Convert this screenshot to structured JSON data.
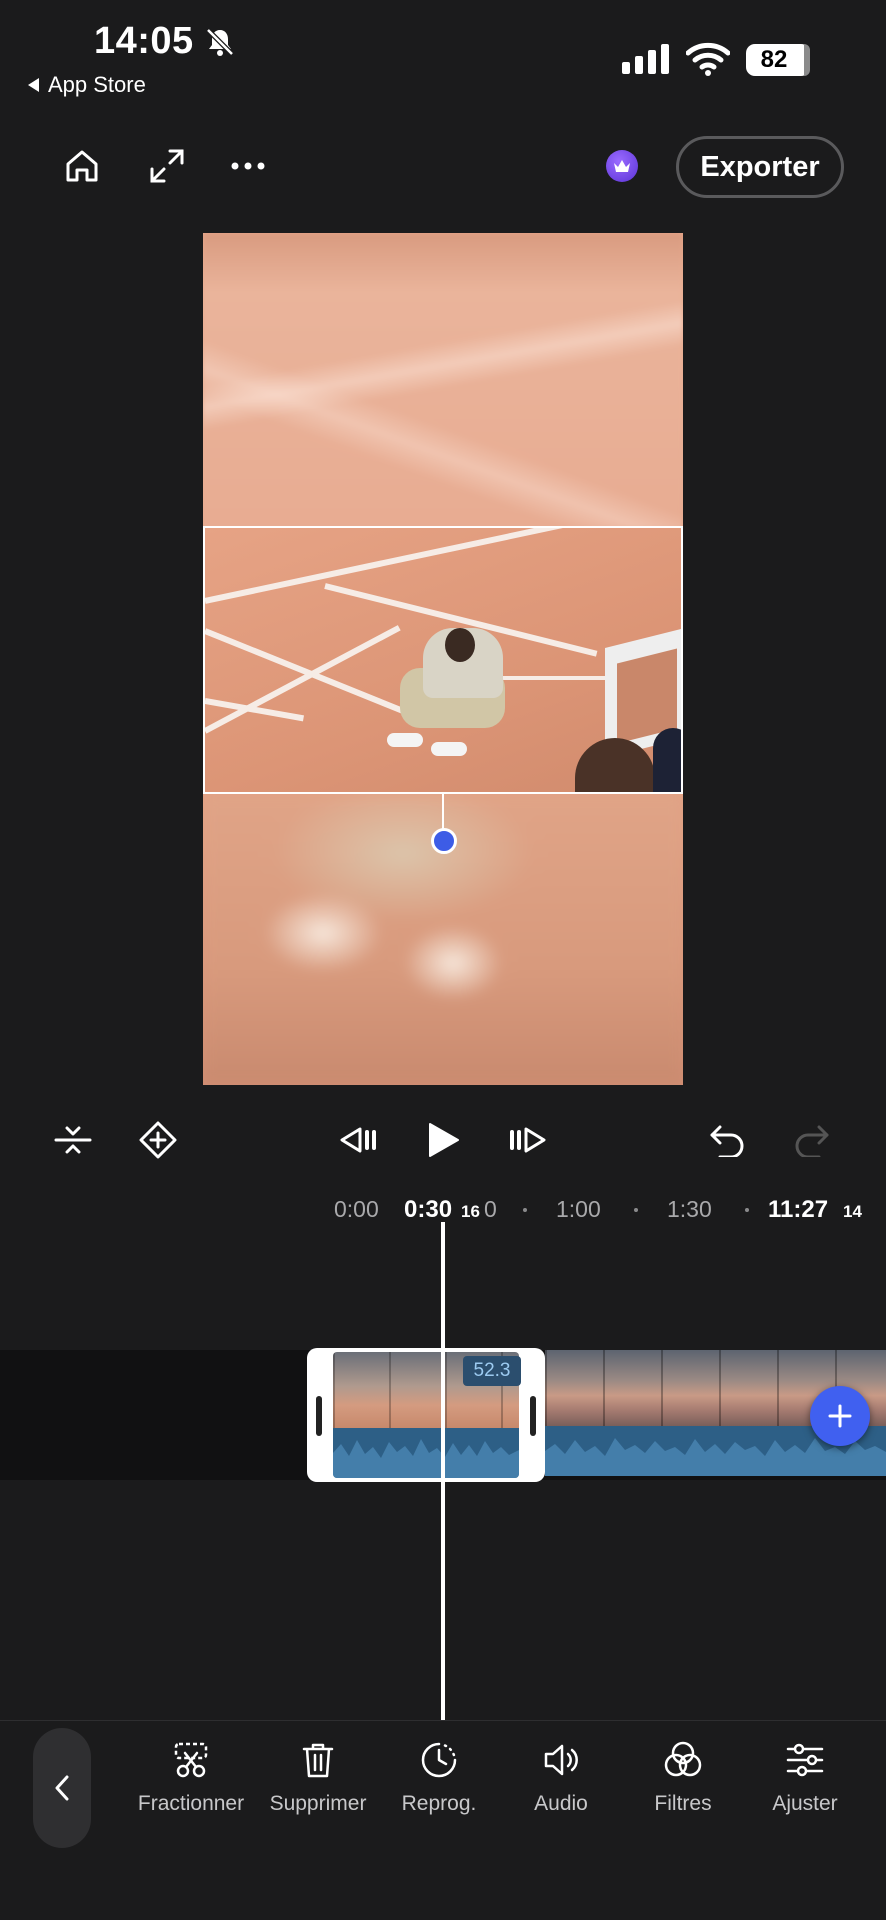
{
  "status_bar": {
    "time": "14:05",
    "back_app": "App Store",
    "battery": "82"
  },
  "toolbar": {
    "home_icon": "home-icon",
    "fullscreen_icon": "expand-icon",
    "more_icon": "more-icon",
    "premium_icon": "crown-icon",
    "export_label": "Exporter"
  },
  "playback": {
    "split_view_icon": "split-vertical-icon",
    "keyframe_icon": "keyframe-add-icon",
    "prev_frame_icon": "step-back-icon",
    "play_icon": "play-icon",
    "next_frame_icon": "step-forward-icon",
    "undo_icon": "undo-icon",
    "redo_icon": "redo-icon"
  },
  "ruler": {
    "marks": [
      "0:00",
      "1:00",
      "1:30"
    ],
    "partial_mark": "0",
    "current_time": "0:30",
    "current_frames": "16",
    "total_time": "11:27",
    "total_frames": "14"
  },
  "timeline": {
    "clip_speed": "52.3",
    "add_icon": "plus-icon"
  },
  "bottom_tools": {
    "back_icon": "chevron-left-icon",
    "items": [
      {
        "label": "Fractionner",
        "icon": "split-scissors-icon"
      },
      {
        "label": "Supprimer",
        "icon": "trash-icon"
      },
      {
        "label": "Reprog.",
        "icon": "clock-dashed-icon"
      },
      {
        "label": "Audio",
        "icon": "speaker-icon"
      },
      {
        "label": "Filtres",
        "icon": "filters-circles-icon"
      },
      {
        "label": "Ajuster",
        "icon": "sliders-icon"
      }
    ]
  },
  "colors": {
    "background": "#1b1b1c",
    "accent": "#4060f0",
    "premium": "#7a4cf0"
  }
}
